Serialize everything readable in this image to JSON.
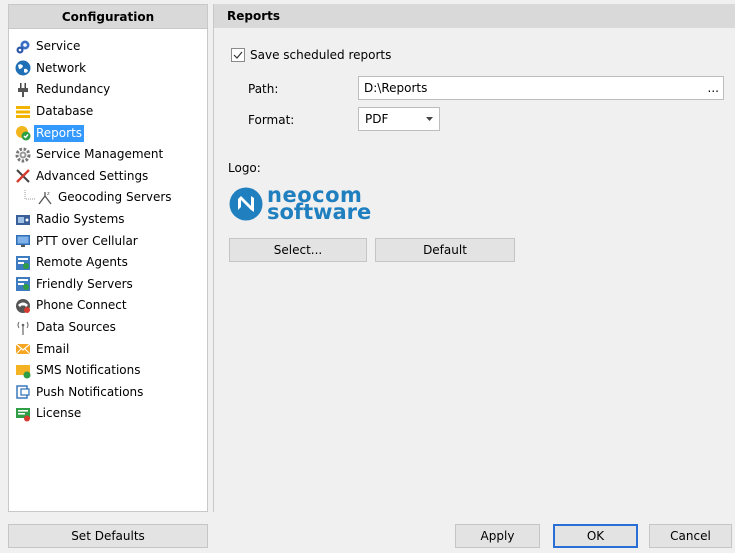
{
  "left": {
    "header": "Configuration",
    "items": [
      {
        "label": "Service",
        "icon": "gears-icon"
      },
      {
        "label": "Network",
        "icon": "globe-icon"
      },
      {
        "label": "Redundancy",
        "icon": "plug-icon"
      },
      {
        "label": "Database",
        "icon": "database-icon"
      },
      {
        "label": "Reports",
        "icon": "reports-icon",
        "selected": true
      },
      {
        "label": "Service Management",
        "icon": "gear-icon"
      },
      {
        "label": "Advanced Settings",
        "icon": "tools-icon"
      },
      {
        "label": "Geocoding Servers",
        "icon": "geocoding-icon",
        "sub": true
      },
      {
        "label": "Radio Systems",
        "icon": "radio-icon"
      },
      {
        "label": "PTT over Cellular",
        "icon": "monitor-icon"
      },
      {
        "label": "Remote Agents",
        "icon": "agents-icon"
      },
      {
        "label": "Friendly Servers",
        "icon": "servers-icon"
      },
      {
        "label": "Phone Connect",
        "icon": "phone-icon"
      },
      {
        "label": "Data Sources",
        "icon": "antenna-icon"
      },
      {
        "label": "Email",
        "icon": "email-icon"
      },
      {
        "label": "SMS Notifications",
        "icon": "sms-icon"
      },
      {
        "label": "Push Notifications",
        "icon": "push-icon"
      },
      {
        "label": "License",
        "icon": "license-icon"
      }
    ]
  },
  "right": {
    "header": "Reports",
    "save_scheduled_label": "Save scheduled reports",
    "save_scheduled_checked": true,
    "path_label": "Path:",
    "path_value": "D:\\Reports",
    "path_browse": "...",
    "format_label": "Format:",
    "format_value": "PDF",
    "logo_label": "Logo:",
    "logo_line1": "neocom",
    "logo_line2": "software",
    "select_button": "Select...",
    "default_button": "Default"
  },
  "footer": {
    "set_defaults": "Set Defaults",
    "apply": "Apply",
    "ok": "OK",
    "cancel": "Cancel"
  },
  "colors": {
    "selection": "#3399ff",
    "brand": "#1f7fbf",
    "primary_border": "#2a6fd6"
  }
}
